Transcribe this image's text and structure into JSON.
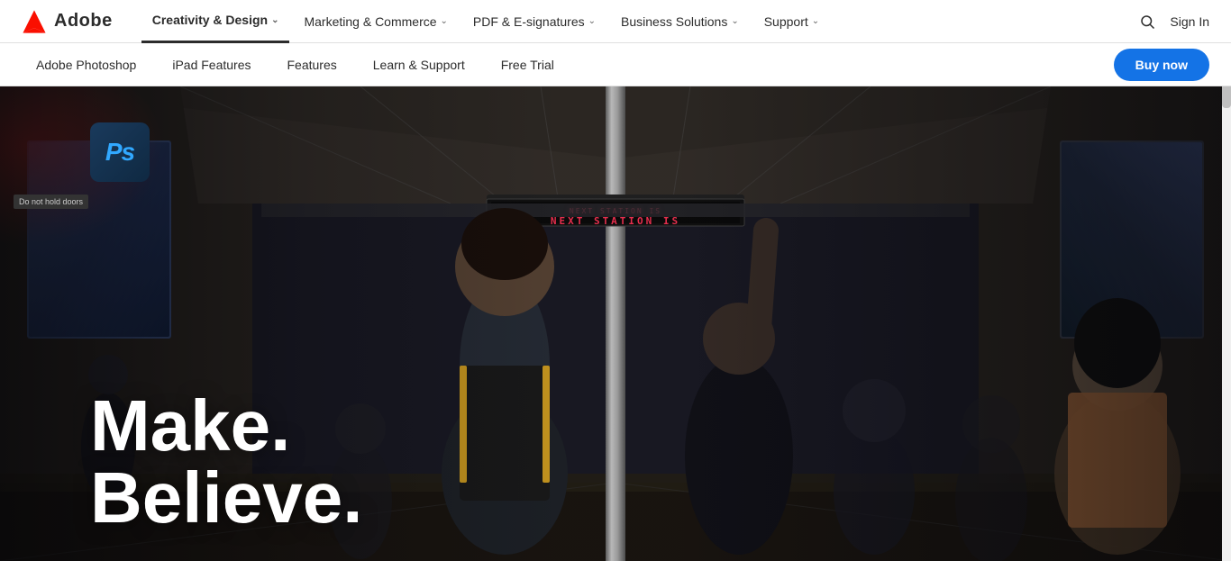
{
  "logo": {
    "brand": "Adobe"
  },
  "topNav": {
    "items": [
      {
        "label": "Creativity & Design",
        "active": true,
        "hasChevron": true
      },
      {
        "label": "Marketing & Commerce",
        "active": false,
        "hasChevron": true
      },
      {
        "label": "PDF & E-signatures",
        "active": false,
        "hasChevron": true
      },
      {
        "label": "Business Solutions",
        "active": false,
        "hasChevron": true
      },
      {
        "label": "Support",
        "active": false,
        "hasChevron": true
      }
    ],
    "signIn": "Sign In",
    "searchIcon": "🔍"
  },
  "subNav": {
    "items": [
      {
        "label": "Adobe Photoshop"
      },
      {
        "label": "iPad Features"
      },
      {
        "label": "Features"
      },
      {
        "label": "Learn & Support"
      },
      {
        "label": "Free Trial"
      }
    ],
    "buyNow": "Buy now"
  },
  "hero": {
    "doorSign": "Do not hold doors",
    "ledTextSmall": "NEXT STATION IS",
    "ledTextLarge": "NEXT STATION IS",
    "psLabel": "Ps",
    "titleLine1": "Make.",
    "titleLine2": "Believe."
  }
}
